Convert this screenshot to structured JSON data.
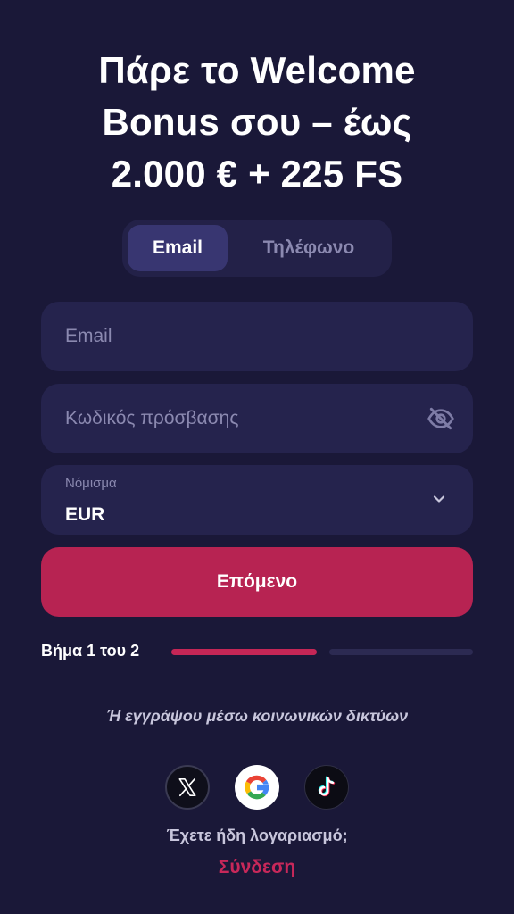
{
  "header": {
    "title_lines": [
      "Πάρε το Welcome",
      "Bonus σου – έως",
      "2.000 € + 225 FS"
    ]
  },
  "tabs": [
    {
      "label": "Email",
      "active": true
    },
    {
      "label": "Τηλέφωνο",
      "active": false
    }
  ],
  "form": {
    "email": {
      "value": "",
      "placeholder": "Email"
    },
    "password": {
      "value": "",
      "placeholder": "Κωδικός πρόσβασης"
    },
    "currency": {
      "label": "Νόμισμα",
      "value": "EUR"
    },
    "next_label": "Επόμενο"
  },
  "progress": {
    "label": "Βήμα 1 του 2",
    "current_step": 1,
    "total_steps": 2
  },
  "social": {
    "text": "Ή εγγράψου μέσω κοινωνικών δικτύων",
    "providers": [
      {
        "name": "x-icon"
      },
      {
        "name": "google-icon"
      },
      {
        "name": "tiktok-icon"
      }
    ]
  },
  "footer": {
    "have_account": "Έχετε ήδη λογαριασμό;",
    "login_label": "Σύνδεση"
  },
  "colors": {
    "background": "#1a1838",
    "accent": "#b72352",
    "field_bg": "#25234d"
  }
}
